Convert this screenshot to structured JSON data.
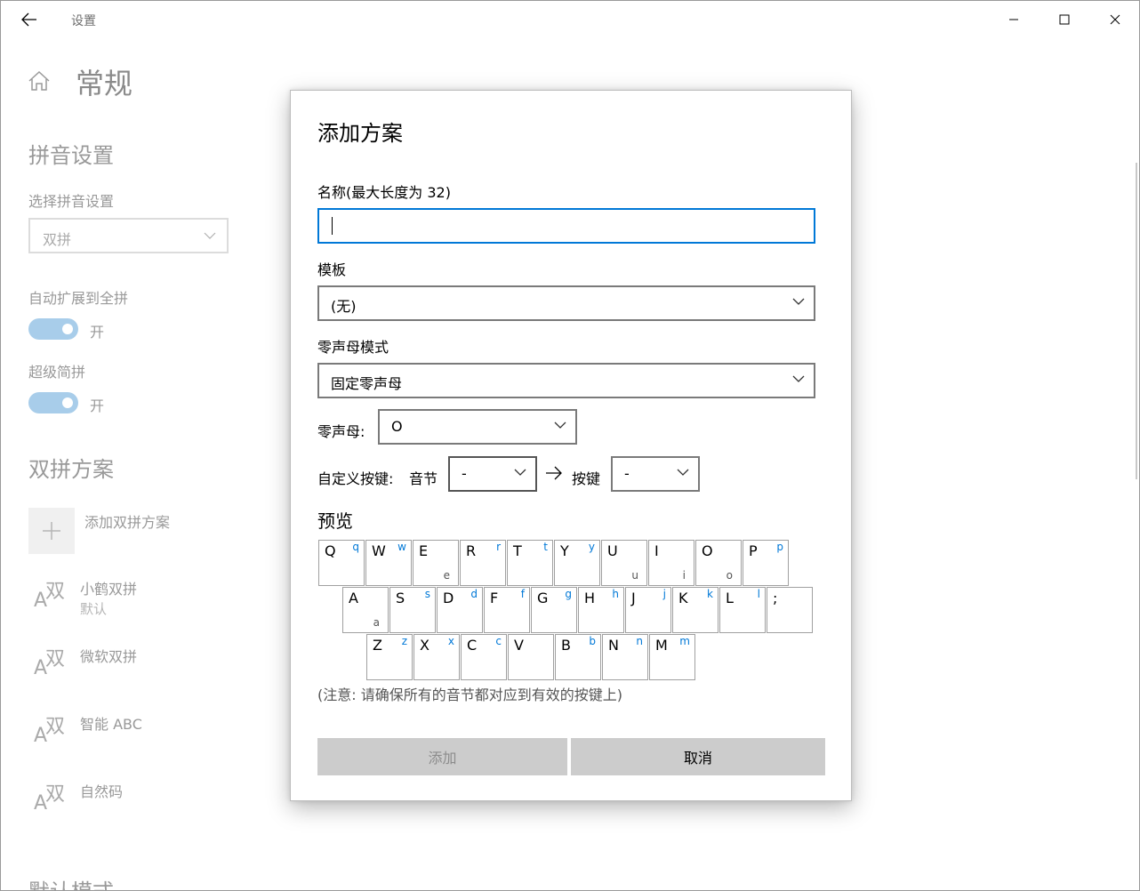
{
  "window": {
    "app_title": "设置"
  },
  "page": {
    "title": "常规",
    "pinyin_section": "拼音设置",
    "select_pinyin_label": "选择拼音设置",
    "select_pinyin_value": "双拼",
    "auto_expand_label": "自动扩展到全拼",
    "auto_expand_state": "开",
    "super_abbrev_label": "超级简拼",
    "super_abbrev_state": "开",
    "shuangpin_section": "双拼方案",
    "add_scheme_label": "添加双拼方案",
    "schemes": [
      {
        "name": "小鹤双拼",
        "sub": "默认"
      },
      {
        "name": "微软双拼"
      },
      {
        "name": "智能 ABC"
      },
      {
        "name": "自然码"
      }
    ],
    "scheme_icon_text": {
      "a": "A",
      "s": "双"
    },
    "bottom_section": "默认模式"
  },
  "dialog": {
    "title": "添加方案",
    "name_label": "名称(最大长度为 32)",
    "name_value": "",
    "template_label": "模板",
    "template_value": "(无)",
    "zero_mode_label": "零声母模式",
    "zero_mode_value": "固定零声母",
    "zero_initial_label": "零声母:",
    "zero_initial_value": "O",
    "custom_key_label": "自定义按键:",
    "syllable_label": "音节",
    "syllable_value": "-",
    "key_label": "按键",
    "key_value": "-",
    "preview_title": "预览",
    "keyboard": {
      "row1": [
        {
          "k": "Q",
          "v": "q"
        },
        {
          "k": "W",
          "v": "w"
        },
        {
          "k": "E",
          "z": "e"
        },
        {
          "k": "R",
          "v": "r"
        },
        {
          "k": "T",
          "v": "t"
        },
        {
          "k": "Y",
          "v": "y"
        },
        {
          "k": "U",
          "z": "u"
        },
        {
          "k": "I",
          "z": "i"
        },
        {
          "k": "O",
          "z": "o"
        },
        {
          "k": "P",
          "v": "p"
        }
      ],
      "row2": [
        {
          "k": "A",
          "z": "a"
        },
        {
          "k": "S",
          "v": "s"
        },
        {
          "k": "D",
          "v": "d"
        },
        {
          "k": "F",
          "v": "f"
        },
        {
          "k": "G",
          "v": "g"
        },
        {
          "k": "H",
          "v": "h"
        },
        {
          "k": "J",
          "v": "j"
        },
        {
          "k": "K",
          "v": "k"
        },
        {
          "k": "L",
          "v": "l"
        },
        {
          "k": ";"
        }
      ],
      "row3": [
        {
          "k": "Z",
          "v": "z"
        },
        {
          "k": "X",
          "v": "x"
        },
        {
          "k": "C",
          "v": "c"
        },
        {
          "k": "V"
        },
        {
          "k": "B",
          "v": "b"
        },
        {
          "k": "N",
          "v": "n"
        },
        {
          "k": "M",
          "v": "m"
        }
      ]
    },
    "note": "(注意: 请确保所有的音节都对应到有效的按键上)",
    "add_button": "添加",
    "cancel_button": "取消"
  },
  "colors": {
    "accent": "#0078d7",
    "toggle_on": "#a8cdea",
    "button_bg": "#cccccc"
  }
}
